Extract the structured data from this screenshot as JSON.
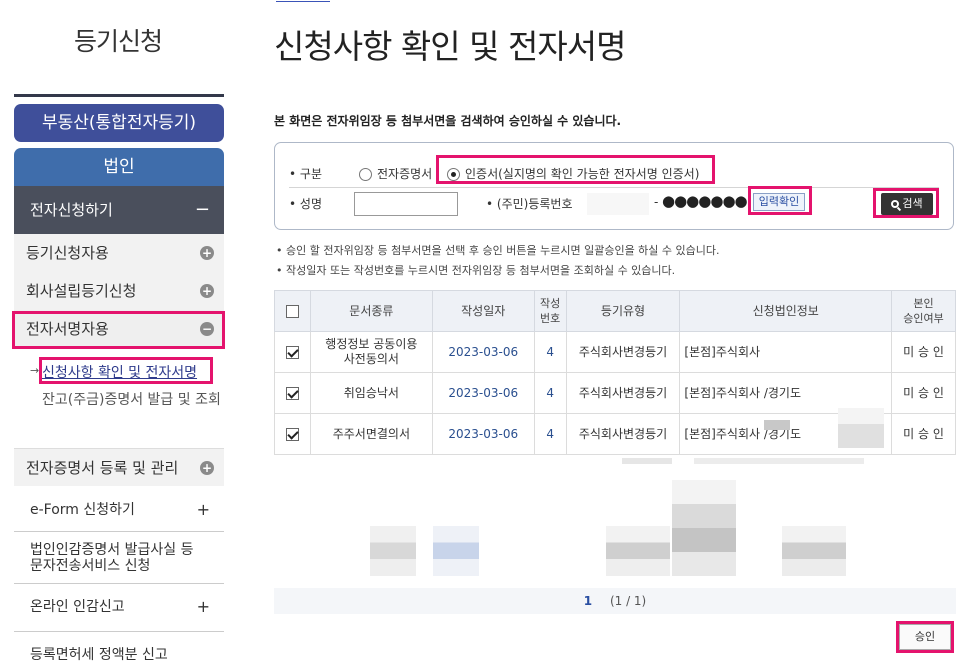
{
  "sidebar": {
    "title": "등기신청",
    "btn_realestate": "부동산(통합전자등기)",
    "btn_corp": "법인",
    "menu_head": "전자신청하기",
    "menu_head_sign": "−",
    "sub_items": [
      "등기신청자용",
      "회사설립등기신청",
      "전자서명자용"
    ],
    "subsub": [
      "신청사항 확인 및 전자서명",
      "잔고(주금)증명서 발급 및 조회"
    ],
    "cert_item": "전자증명서 등록 및 관리",
    "plain_items": [
      "e-Form 신청하기",
      "법인인감증명서 발급사실 등 문자전송서비스 신청",
      "온라인 인감신고",
      "등록면허세 정액분 신고"
    ]
  },
  "page": {
    "title": "신청사항 확인 및 전자서명",
    "description": "본 화면은 전자위임장 등 첨부서면을 검색하여 승인하실 수 있습니다."
  },
  "search": {
    "gubun_label": "구분",
    "radio_1": "전자증명서",
    "radio_2": "인증서(실지명의 확인 가능한 전자서명 인증서)",
    "name_label": "성명",
    "reg_label": "(주민)등록번호",
    "reg_masked": "●●●●●●●",
    "verify_btn": "입력확인",
    "search_btn": "검색"
  },
  "notes": [
    "승인 할 전자위임장 등 첨부서면을 선택 후 승인 버튼을 누르시면 일괄승인을 하실 수 있습니다.",
    "작성일자 또는 작성번호를 누르시면 전자위임장 등 첨부서면을 조회하실 수 있습니다."
  ],
  "table": {
    "headers": [
      "문서종류",
      "작성일자",
      "작성\n번호",
      "등기유형",
      "신청법인정보",
      "본인\n승인여부"
    ],
    "rows": [
      {
        "doc": "행정정보 공동이용 사전동의서",
        "date": "2023-03-06",
        "no": "4",
        "type": "주식회사변경등기",
        "info": "[본점]주식회사",
        "status": "미 승 인"
      },
      {
        "doc": "취임승낙서",
        "date": "2023-03-06",
        "no": "4",
        "type": "주식회사변경등기",
        "info": "[본점]주식회사 /경기도",
        "status": "미 승 인"
      },
      {
        "doc": "주주서면결의서",
        "date": "2023-03-06",
        "no": "4",
        "type": "주식회사변경등기",
        "info": "[본점]주식회사 /경기도",
        "status": "미 승 인"
      }
    ]
  },
  "pager": {
    "current": "1",
    "summary": "(1 / 1)"
  },
  "approve_btn": "승인",
  "colors": {
    "accent_highlight": "#e4136d",
    "dark_nav": "#4a4f5c",
    "realestate_btn": "#3f4f9a",
    "corp_btn": "#3f6dab"
  }
}
